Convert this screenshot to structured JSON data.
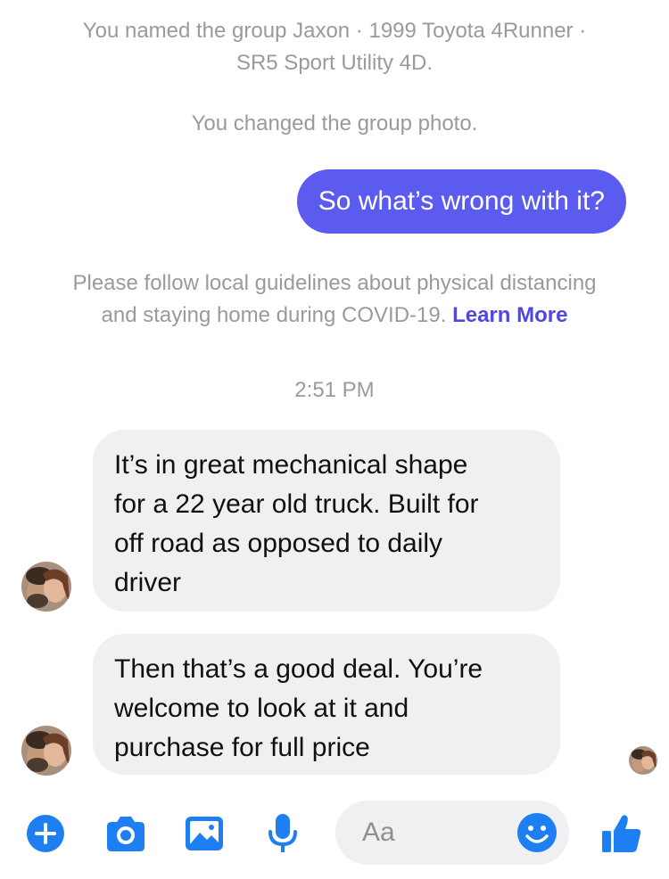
{
  "system_messages": {
    "group_named": "You named the group Jaxon · 1999 Toyota 4Runner ·",
    "group_named_line2": "SR5 Sport Utility 4D.",
    "photo_changed": "You changed the group photo."
  },
  "outgoing": {
    "text": "So what’s wrong with it?"
  },
  "notice": {
    "line1": "Please follow local guidelines about physical distancing",
    "line2": "and staying home during COVID-19.",
    "link": "Learn More"
  },
  "timestamp": "2:51 PM",
  "incoming": [
    {
      "lines": [
        "It’s in great mechanical shape",
        "for a 22 year old truck. Built for",
        "off road as opposed to daily",
        "driver"
      ]
    },
    {
      "lines": [
        "Then that’s a good deal. You’re",
        "welcome to look at it and",
        "purchase for full price"
      ]
    }
  ],
  "composer": {
    "placeholder": "Aa"
  },
  "icons": {
    "plus": "plus-circle-icon",
    "camera": "camera-icon",
    "gallery": "photo-gallery-icon",
    "mic": "microphone-icon",
    "emoji": "smiley-icon",
    "like": "thumbs-up-icon"
  },
  "colors": {
    "accent": "#5b5bf0",
    "icon_blue": "#1e7ff2",
    "link": "#4f46e5",
    "bubble_in": "#f0f0f0",
    "system_text": "#9a9a9e"
  }
}
